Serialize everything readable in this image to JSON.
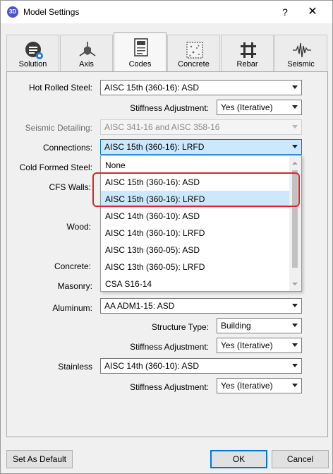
{
  "window": {
    "title": "Model Settings",
    "app_icon_text": "3D",
    "help": "?",
    "close": "✕"
  },
  "tabs": [
    {
      "label": "Solution",
      "icon": "solution-icon"
    },
    {
      "label": "Axis",
      "icon": "axis-icon"
    },
    {
      "label": "Codes",
      "icon": "codes-icon",
      "active": true
    },
    {
      "label": "Concrete",
      "icon": "concrete-icon"
    },
    {
      "label": "Rebar",
      "icon": "rebar-icon"
    },
    {
      "label": "Seismic",
      "icon": "seismic-icon"
    }
  ],
  "fields": {
    "hot_rolled_steel": {
      "label": "Hot Rolled Steel:",
      "value": "AISC 15th (360-16): ASD"
    },
    "stiffness_adjustment_1": {
      "label": "Stiffness Adjustment:",
      "value": "Yes (Iterative)"
    },
    "seismic_detailing": {
      "label": "Seismic Detailing:",
      "value": "AISC 341-16 and AISC 358-16"
    },
    "connections": {
      "label": "Connections:",
      "value": "AISC 15th (360-16): LRFD"
    },
    "cold_formed_steel": {
      "label": "Cold Formed Steel:"
    },
    "cfs_walls": {
      "label": "CFS Walls:"
    },
    "wood": {
      "label": "Wood:"
    },
    "concrete": {
      "label": "Concrete:"
    },
    "masonry": {
      "label": "Masonry:"
    },
    "aluminum": {
      "label": "Aluminum:",
      "value": "AA ADM1-15: ASD"
    },
    "structure_type": {
      "label": "Structure Type:",
      "value": "Building"
    },
    "stiffness_adjustment_2": {
      "label": "Stiffness Adjustment:",
      "value": "Yes (Iterative)"
    },
    "stainless": {
      "label": "Stainless",
      "value": "AISC 14th (360-10): ASD"
    },
    "stiffness_adjustment_3": {
      "label": "Stiffness Adjustment:",
      "value": "Yes (Iterative)"
    }
  },
  "dropdown": {
    "items": [
      "None",
      "AISC 15th (360-16): ASD",
      "AISC 15th (360-16): LRFD",
      "AISC 14th (360-10): ASD",
      "AISC 14th (360-10): LRFD",
      "AISC 13th (360-05): ASD",
      "AISC 13th (360-05): LRFD",
      "CSA S16-14"
    ],
    "selected_index": 2
  },
  "buttons": {
    "set_default": "Set As Default",
    "ok": "OK",
    "cancel": "Cancel"
  },
  "colors": {
    "selection": "#cce8ff",
    "focus_border": "#0078d7",
    "highlight": "#e0212b"
  }
}
